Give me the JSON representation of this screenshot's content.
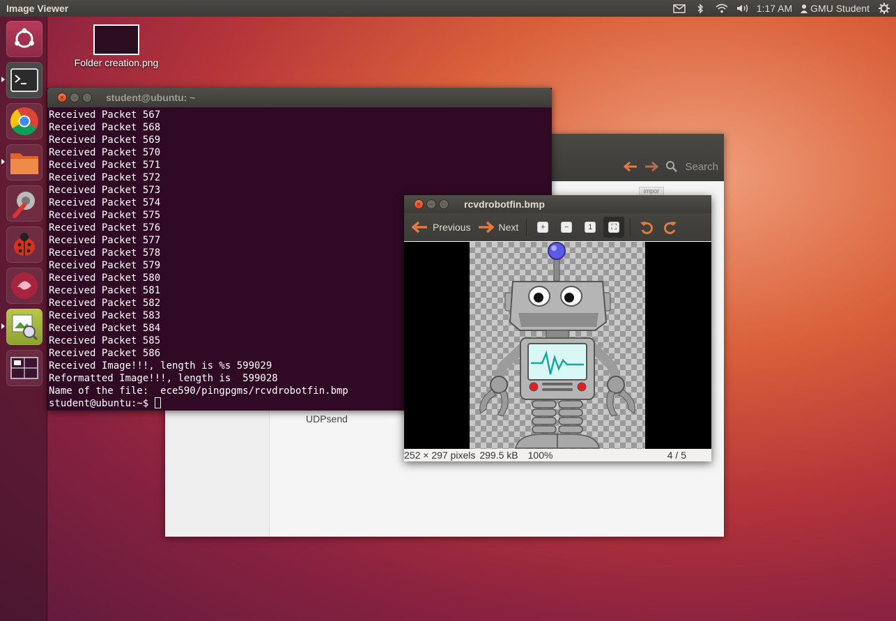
{
  "topbar": {
    "app_title": "Image Viewer",
    "time": "1:17 AM",
    "user": "GMU Student",
    "icons": [
      "mail-icon",
      "bluetooth-icon",
      "wifi-icon",
      "volume-icon",
      "user-icon",
      "gear-icon"
    ]
  },
  "launcher": {
    "items": [
      "ubuntu-dash",
      "terminal",
      "chromium",
      "files",
      "system-settings",
      "bug-reporter",
      "app-store",
      "image-viewer",
      "workspace-switcher"
    ]
  },
  "desktop": {
    "icon_label": "Folder creation.png"
  },
  "file_manager": {
    "search_label": "Search",
    "file_label": "UDPsend",
    "partial_label": "impor"
  },
  "terminal": {
    "title": "student@ubuntu: ~",
    "lines": [
      "Received Packet 567",
      "Received Packet 568",
      "Received Packet 569",
      "Received Packet 570",
      "Received Packet 571",
      "Received Packet 572",
      "Received Packet 573",
      "Received Packet 574",
      "Received Packet 575",
      "Received Packet 576",
      "Received Packet 577",
      "Received Packet 578",
      "Received Packet 579",
      "Received Packet 580",
      "Received Packet 581",
      "Received Packet 582",
      "Received Packet 583",
      "Received Packet 584",
      "Received Packet 585",
      "Received Packet 586",
      "Received Image!!!, length is %s 599029",
      "Reformatted Image!!!, length is  599028",
      "Name of the file:  ece590/pingpgms/rcvdrobotfin.bmp"
    ],
    "prompt": "student@ubuntu:~$ "
  },
  "viewer": {
    "title": "rcvdrobotfin.bmp",
    "previous_label": "Previous",
    "next_label": "Next",
    "status_dims": "252 × 297 pixels",
    "status_size": "299.5 kB",
    "status_zoom": "100%",
    "status_index": "4 / 5"
  },
  "colors": {
    "accent_orange": "#dd4814",
    "terminal_bg": "#300a24",
    "panel_dark": "#3c3b37"
  }
}
